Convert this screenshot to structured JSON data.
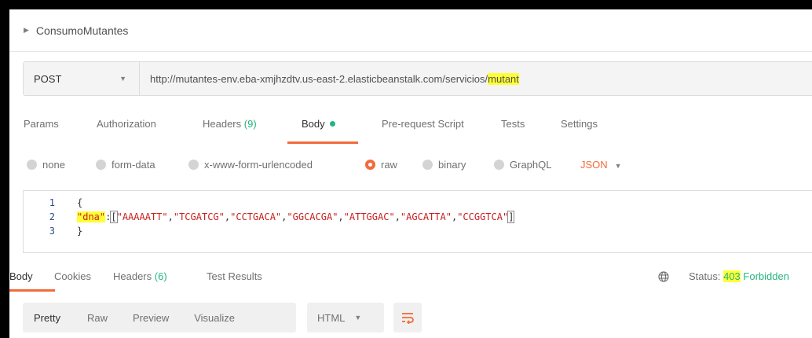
{
  "collection": {
    "name": "ConsumoMutantes"
  },
  "request": {
    "method": "POST",
    "url_base": "http://mutantes-env.eba-xmjhzdtv.us-east-2.elasticbeanstalk.com/servicios/",
    "url_highlight": "mutant"
  },
  "request_tabs": {
    "params": "Params",
    "authorization": "Authorization",
    "headers": "Headers",
    "headers_count": "(9)",
    "body": "Body",
    "prerequest": "Pre-request Script",
    "tests": "Tests",
    "settings": "Settings"
  },
  "body_types": {
    "none": "none",
    "form_data": "form-data",
    "urlencoded": "x-www-form-urlencoded",
    "raw": "raw",
    "binary": "binary",
    "graphql": "GraphQL",
    "format": "JSON",
    "selected": "raw"
  },
  "editor": {
    "line_numbers": [
      "1",
      "2",
      "3"
    ],
    "open_brace": "{",
    "close_brace": "}",
    "key": "\"dna\"",
    "colon": ":",
    "open_bracket": "[",
    "close_bracket": "]",
    "values": [
      "\"AAAAATT\"",
      "\"TCGATCG\"",
      "\"CCTGACA\"",
      "\"GGCACGA\"",
      "\"ATTGGAC\"",
      "\"AGCATTA\"",
      "\"CCGGTCA\""
    ]
  },
  "response_tabs": {
    "body": "Body",
    "cookies": "Cookies",
    "headers": "Headers",
    "headers_count": "(6)",
    "test_results": "Test Results"
  },
  "status": {
    "label": "Status:",
    "code": "403",
    "text": "Forbidden"
  },
  "response_toolbar": {
    "pretty": "Pretty",
    "raw": "Raw",
    "preview": "Preview",
    "visualize": "Visualize",
    "format": "HTML"
  },
  "colors": {
    "accent": "#f26b3a",
    "success": "#26b47f",
    "highlight": "#ffff35",
    "string": "#c8201e"
  }
}
